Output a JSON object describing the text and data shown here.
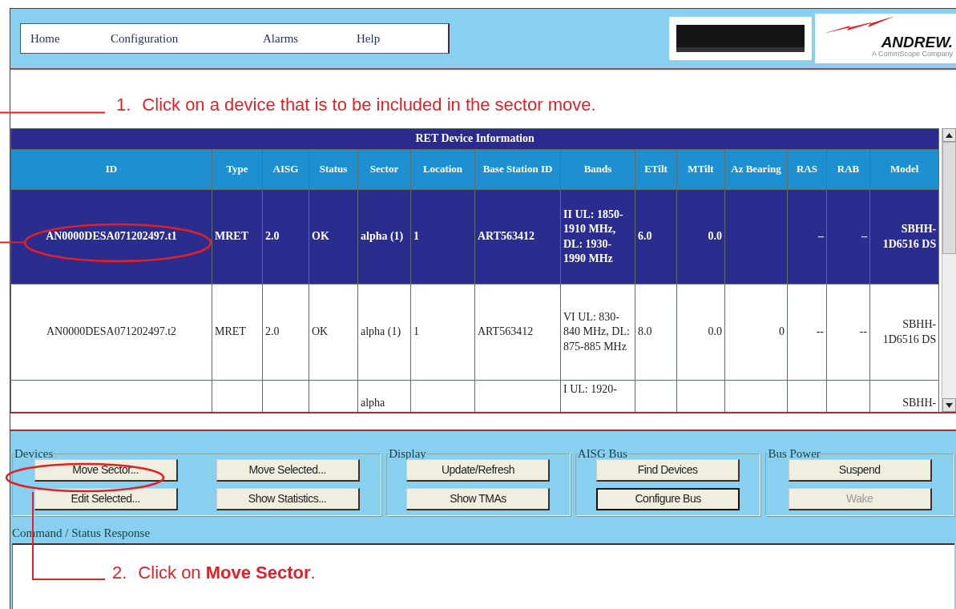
{
  "menu": [
    "Home",
    "Configuration",
    "Alarms",
    "Help"
  ],
  "logo": {
    "wordmark": "ANDREW.",
    "tagline": "A CommScope Company"
  },
  "annotations": [
    {
      "number": "1.",
      "text": "Click on a device that is to be included in the sector move."
    },
    {
      "number": "2.",
      "text": "Click on **Move Sector**."
    }
  ],
  "table": {
    "title": "RET Device Information",
    "columns": [
      "ID",
      "Type",
      "AISG",
      "Status",
      "Sector",
      "Location",
      "Base Station ID",
      "Bands",
      "ETilt",
      "MTilt",
      "Az Bearing",
      "RAS",
      "RAB",
      "Model"
    ],
    "rows": [
      {
        "selected": true,
        "cells": [
          "AN0000DESA071202497.t1",
          "MRET",
          "2.0",
          "OK",
          "alpha (1)",
          "1",
          "ART563412",
          "II UL: 1850-1910 MHz, DL: 1930-1990 MHz",
          "6.0",
          "0.0",
          null,
          "–",
          "–",
          "SBHH-1D6516 DS"
        ]
      },
      {
        "selected": false,
        "cells": [
          "AN0000DESA071202497.t2",
          "MRET",
          "2.0",
          "OK",
          "alpha (1)",
          "1",
          "ART563412",
          "VI UL: 830-840 MHz, DL: 875-885 MHz",
          "8.0",
          "0.0",
          "0",
          "--",
          "--",
          "SBHH-1D6516 DS"
        ]
      },
      {
        "selected": false,
        "cells": [
          null,
          null,
          null,
          null,
          "alpha",
          null,
          null,
          "I UL: 1920-",
          null,
          null,
          null,
          null,
          null,
          "SBHH-"
        ]
      }
    ]
  },
  "button_groups": [
    {
      "legend": "Devices",
      "buttons": [
        {
          "label": "Move Sector...",
          "disabled": false,
          "focused": false
        },
        {
          "label": "Move Selected...",
          "disabled": false,
          "focused": false
        },
        {
          "label": "Edit Selected...",
          "disabled": false,
          "focused": false
        },
        {
          "label": "Show Statistics...",
          "disabled": false,
          "focused": false
        }
      ]
    },
    {
      "legend": "Display",
      "buttons": [
        {
          "label": "Update/Refresh",
          "disabled": false,
          "focused": false
        },
        {
          "label": "Show TMAs",
          "disabled": false,
          "focused": false
        }
      ]
    },
    {
      "legend": "AISG Bus",
      "buttons": [
        {
          "label": "Find Devices",
          "disabled": false,
          "focused": false
        },
        {
          "label": "Configure Bus",
          "disabled": false,
          "focused": true
        }
      ]
    },
    {
      "legend": "Bus Power",
      "buttons": [
        {
          "label": "Suspend",
          "disabled": false,
          "focused": false
        },
        {
          "label": "Wake",
          "disabled": true,
          "focused": false
        }
      ]
    }
  ],
  "response": {
    "label": "Command / Status Response"
  }
}
